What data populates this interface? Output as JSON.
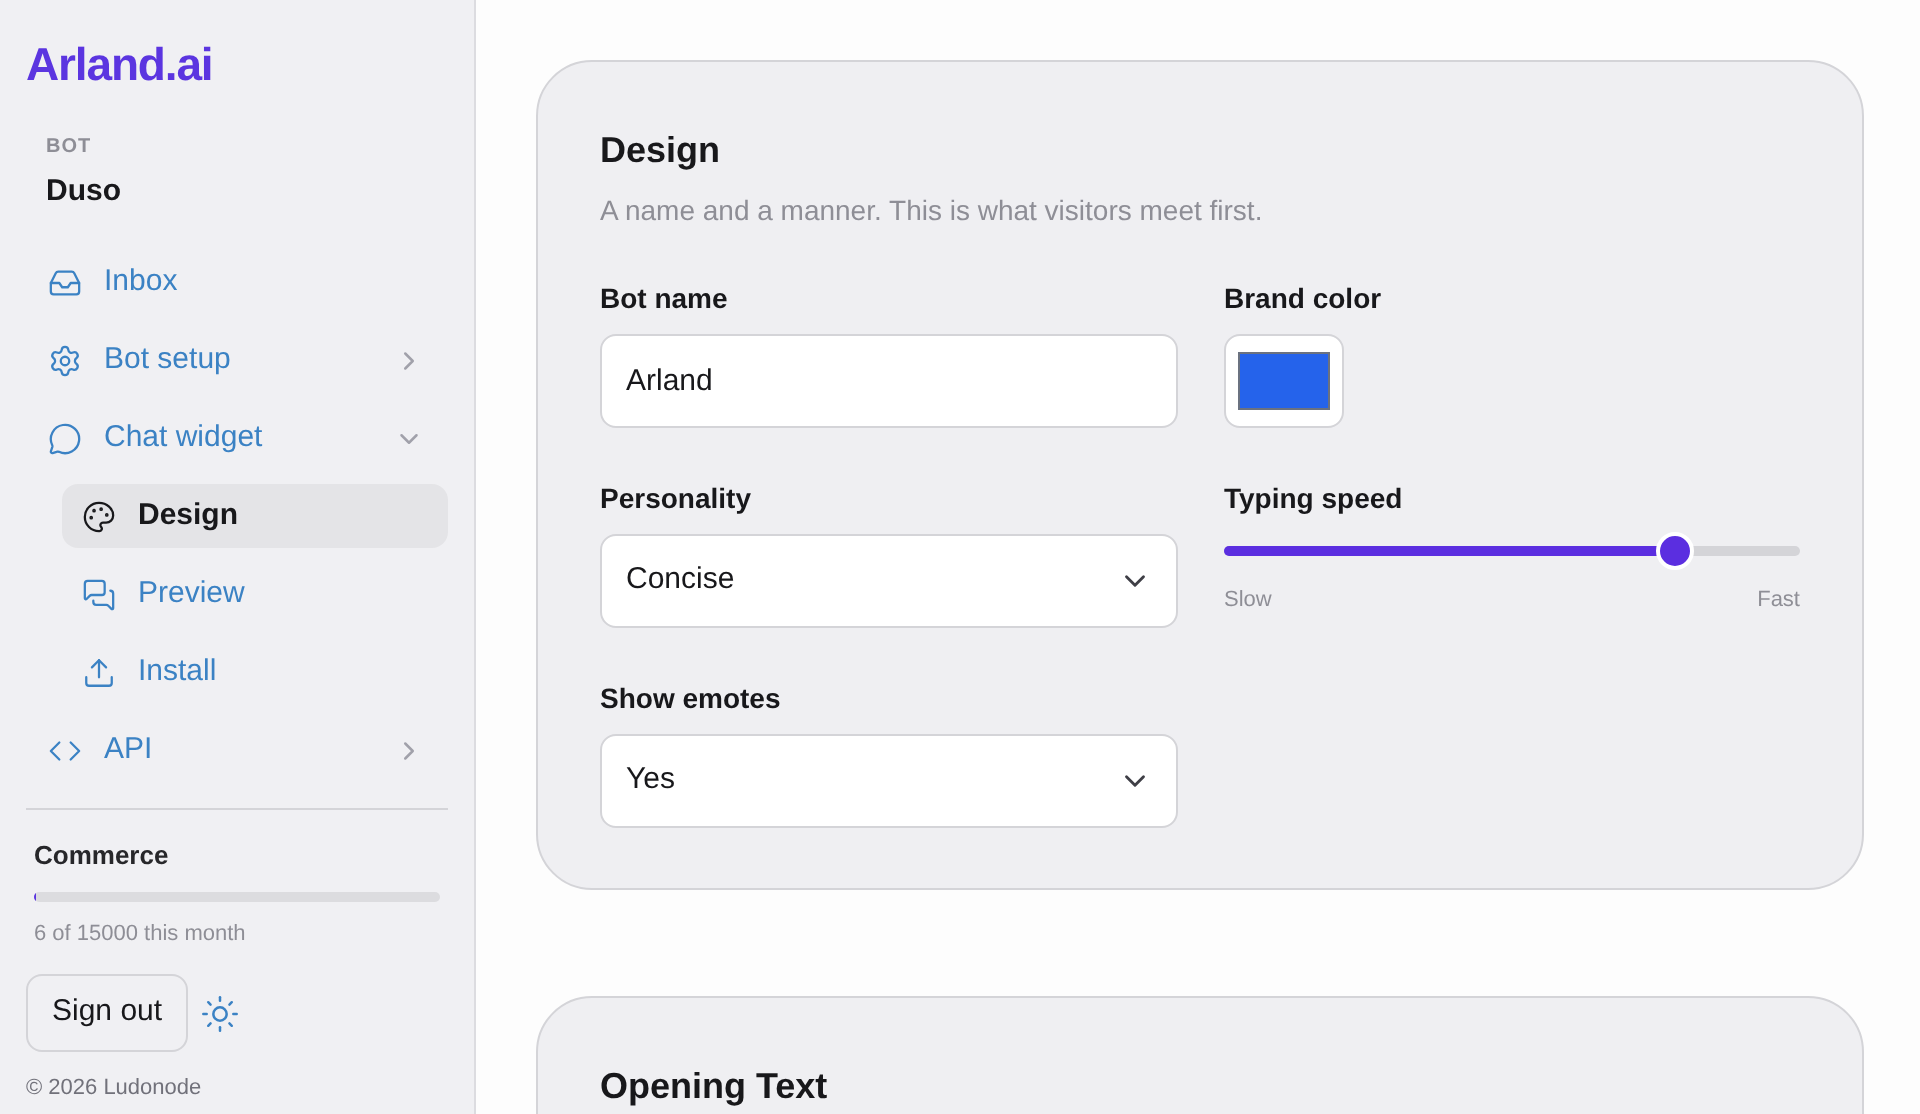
{
  "brand": {
    "logo": "Arland.ai"
  },
  "bot": {
    "label": "BOT",
    "name": "Duso"
  },
  "nav": [
    {
      "label": "Inbox",
      "selected": false
    },
    {
      "label": "Bot setup",
      "selected": false,
      "expanded": false
    },
    {
      "label": "Chat widget",
      "selected": false,
      "expanded": true,
      "children": [
        {
          "label": "Design",
          "selected": true
        },
        {
          "label": "Preview",
          "selected": false
        },
        {
          "label": "Install",
          "selected": false
        }
      ]
    },
    {
      "label": "API",
      "selected": false,
      "expanded": false
    }
  ],
  "plan": {
    "name": "Commerce",
    "level": 0.0004,
    "usage": "6 of 15000 this month"
  },
  "sign_out": "Sign out",
  "footer": "© 2026 Ludonode",
  "design": {
    "title": "Design",
    "subtitle": "A name and a manner. This is what visitors meet first.",
    "bot_name": {
      "label": "Bot name",
      "value": "Arland"
    },
    "brand_color": {
      "label": "Brand color",
      "color": "#2563eb"
    },
    "personality": {
      "label": "Personality",
      "value": "Concise"
    },
    "typing_speed": {
      "label": "Typing speed",
      "level": 0.78,
      "min_label": "Slow",
      "max_label": "Fast"
    },
    "show_emotes": {
      "label": "Show emotes",
      "value": "Yes"
    }
  },
  "opening": {
    "title": "Opening Text"
  }
}
